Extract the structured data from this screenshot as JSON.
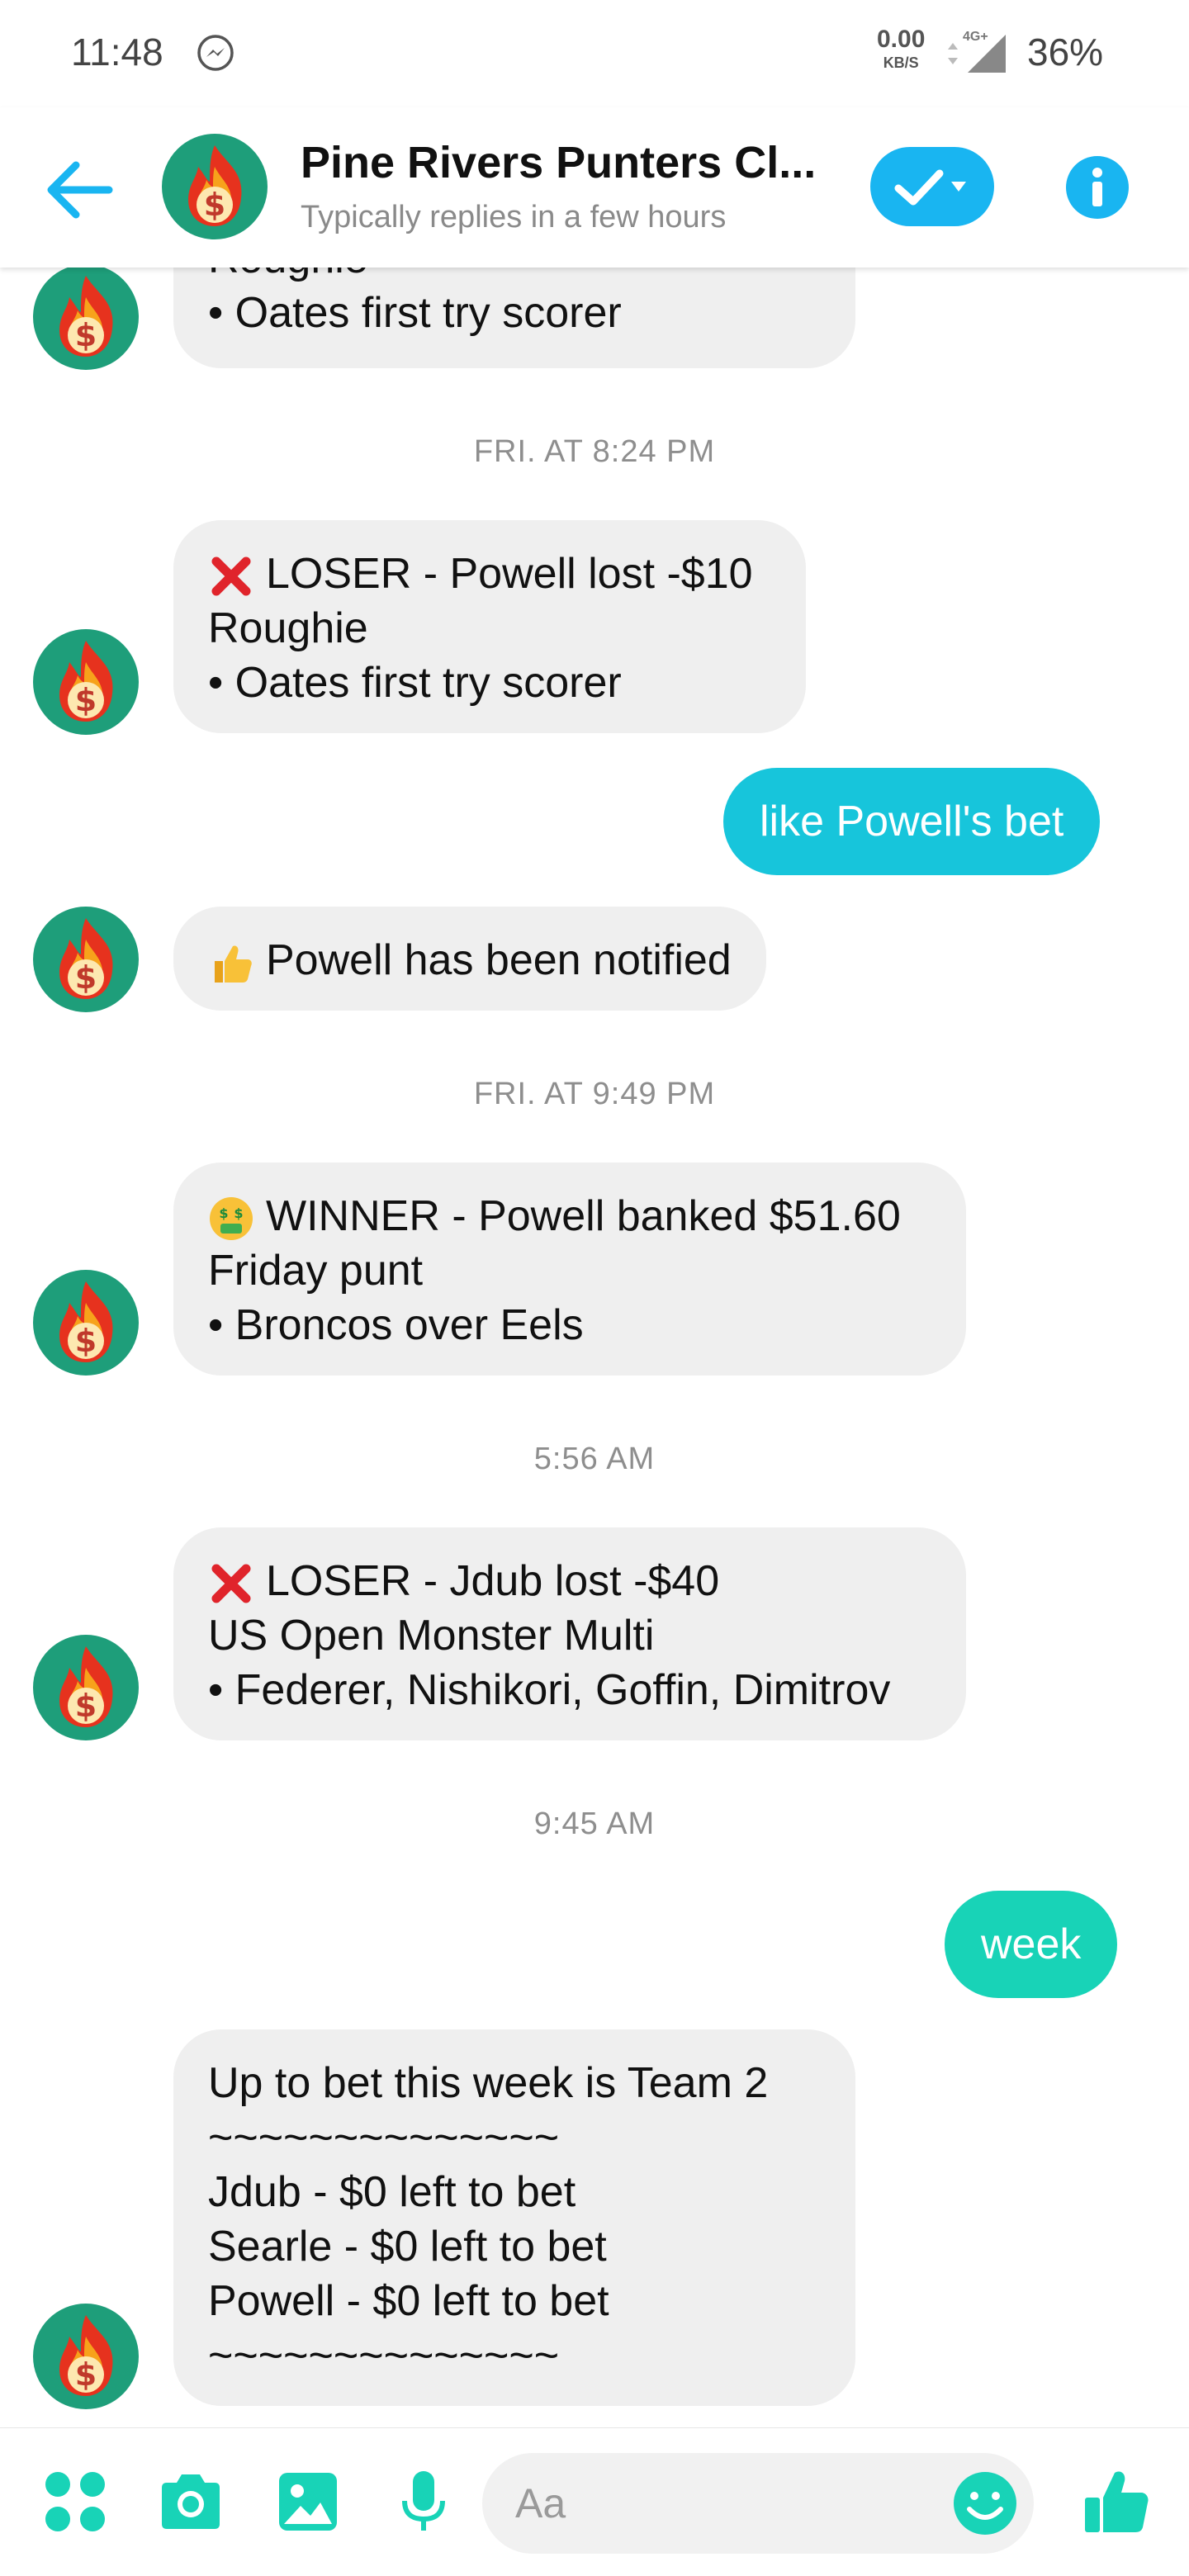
{
  "status_bar": {
    "time": "11:48",
    "net_speed": "0.00",
    "net_unit": "KB/S",
    "network": "4G+",
    "battery": "36%"
  },
  "header": {
    "title": "Pine Rivers Punters Cl...",
    "subtitle": "Typically replies in a few hours",
    "accent": "#19b5f1"
  },
  "messages": [
    {
      "id": "m0",
      "type": "incoming",
      "lines": [
        "Roughie",
        "• Oates first try scorer"
      ]
    },
    {
      "id": "t1",
      "type": "timestamp",
      "text": "FRI. AT 8:24 PM"
    },
    {
      "id": "m1",
      "type": "incoming",
      "lines": [
        "LOSER - Powell lost -$10",
        "Roughie",
        "• Oates first try scorer"
      ],
      "emoji": "cross-mark"
    },
    {
      "id": "m2",
      "type": "outgoing",
      "text": "like Powell's bet",
      "color": "#17c5db"
    },
    {
      "id": "m3",
      "type": "incoming",
      "lines": [
        "Powell has been notified"
      ],
      "emoji": "thumbs-up"
    },
    {
      "id": "t2",
      "type": "timestamp",
      "text": "FRI. AT 9:49 PM"
    },
    {
      "id": "m4",
      "type": "incoming",
      "lines": [
        "WINNER - Powell banked $51.60",
        "Friday punt",
        "• Broncos over Eels"
      ],
      "emoji": "money-mouth-face"
    },
    {
      "id": "t3",
      "type": "timestamp",
      "text": "5:56 AM"
    },
    {
      "id": "m5",
      "type": "incoming",
      "lines": [
        "LOSER - Jdub lost -$40",
        "US Open Monster Multi",
        "• Federer, Nishikori, Goffin, Dimitrov"
      ],
      "emoji": "cross-mark"
    },
    {
      "id": "t4",
      "type": "timestamp",
      "text": "9:45 AM"
    },
    {
      "id": "m6",
      "type": "outgoing",
      "text": "week",
      "color": "#18d3b7"
    },
    {
      "id": "m7",
      "type": "incoming",
      "lines": [
        "Up to bet this week is Team 2",
        "~~~~~~~~~~~~~~",
        "Jdub - $0 left to bet",
        "Searle - $0 left to bet",
        "Powell - $0 left to bet",
        "~~~~~~~~~~~~~~"
      ]
    }
  ],
  "composer": {
    "placeholder": "Aa",
    "accent": "#18d3b7",
    "icons": [
      "more-apps-icon",
      "camera-icon",
      "gallery-icon",
      "microphone-icon",
      "emoji-icon",
      "like-thumb-icon"
    ]
  }
}
